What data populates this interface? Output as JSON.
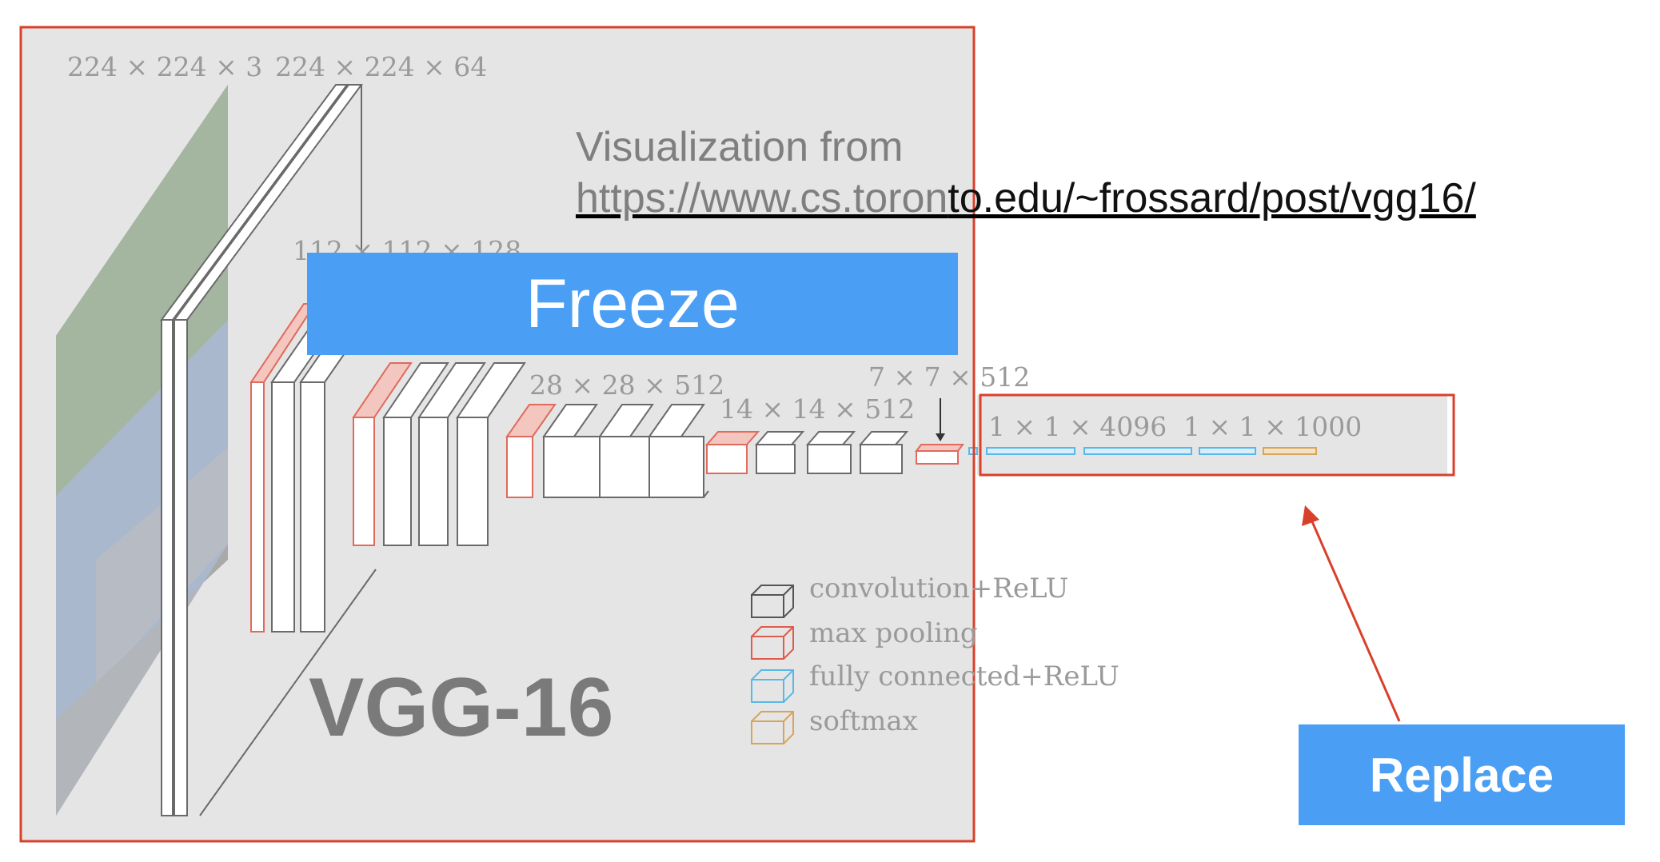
{
  "labels": {
    "input_dims": "224 × 224 × 3",
    "conv1_dims": "224 × 224 × 64",
    "conv2_dims": "112 × 112 × 128",
    "conv4_dims": "28 × 28 × 512",
    "conv5_dims": "14 × 14 × 512",
    "pool5_dims": "7 × 7 × 512",
    "fc_dims": "1 × 1 × 4096",
    "softmax_dims": "1 × 1 × 1000"
  },
  "legend": [
    {
      "label": "convolution+ReLU",
      "color": "#555555"
    },
    {
      "label": "max pooling",
      "color": "#e05b4b"
    },
    {
      "label": "fully connected+ReLU",
      "color": "#5ab8e8"
    },
    {
      "label": "softmax",
      "color": "#d9a45a"
    }
  ],
  "credit": {
    "line1": "Visualization from",
    "url_part1": "https://www.cs.toron",
    "url_part2": "to.edu/~frossard/post/vgg16/"
  },
  "freeze_label": "Freeze",
  "replace_label": "Replace",
  "model_name": "VGG-16",
  "colors": {
    "frame": "#d9402b",
    "overlay": "#e5e5e5",
    "accent_box": "#4a9ff5"
  }
}
